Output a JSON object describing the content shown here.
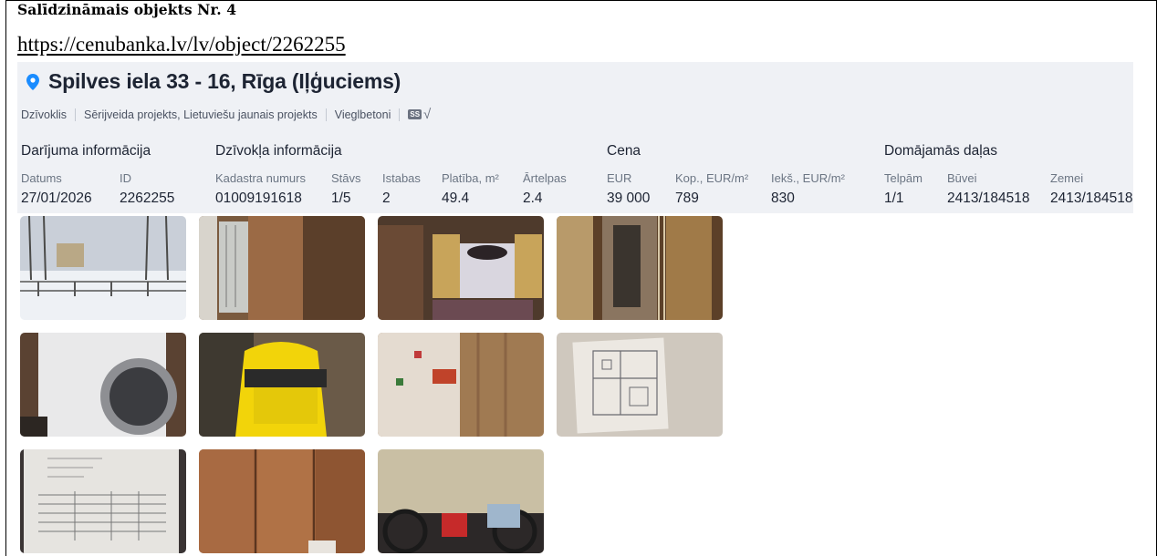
{
  "document": {
    "title": "Salīdzināmais objekts Nr. 4",
    "link": "https://cenubanka.lv/lv/object/2262255"
  },
  "listing": {
    "address": "Spilves iela 33 - 16, Rīga (Iļģuciems)",
    "tags": [
      "Dzīvoklis",
      "Sērijveida projekts, Lietuviešu jaunais projekts",
      "Vieglbetoni"
    ],
    "badge": "SS",
    "icons": [
      "location-pin-icon",
      "checkmark-icon"
    ],
    "accent_color": "#1a8cff",
    "sections": {
      "deal": "Darījuma informācija",
      "apartment": "Dzīvokļa informācija",
      "price": "Cena",
      "shares": "Domājamās daļas"
    },
    "fields": [
      {
        "label": "Datums",
        "value": "27/01/2026"
      },
      {
        "label": "ID",
        "value": "2262255"
      },
      {
        "label": "Kadastra numurs",
        "value": "01009191618"
      },
      {
        "label": "Stāvs",
        "value": "1/5"
      },
      {
        "label": "Istabas",
        "value": "2"
      },
      {
        "label": "Platība, m²",
        "value": "49.4"
      },
      {
        "label": "Ārtelpas",
        "value": "2.4"
      },
      {
        "label": "EUR",
        "value": "39 000"
      },
      {
        "label": "Kop., EUR/m²",
        "value": "789"
      },
      {
        "label": "Iekš., EUR/m²",
        "value": "830"
      },
      {
        "label": "Telpām",
        "value": "1/1"
      },
      {
        "label": "Būvei",
        "value": "2413/184518"
      },
      {
        "label": "Zemei",
        "value": "2413/184518"
      }
    ]
  },
  "photos_count": 11
}
